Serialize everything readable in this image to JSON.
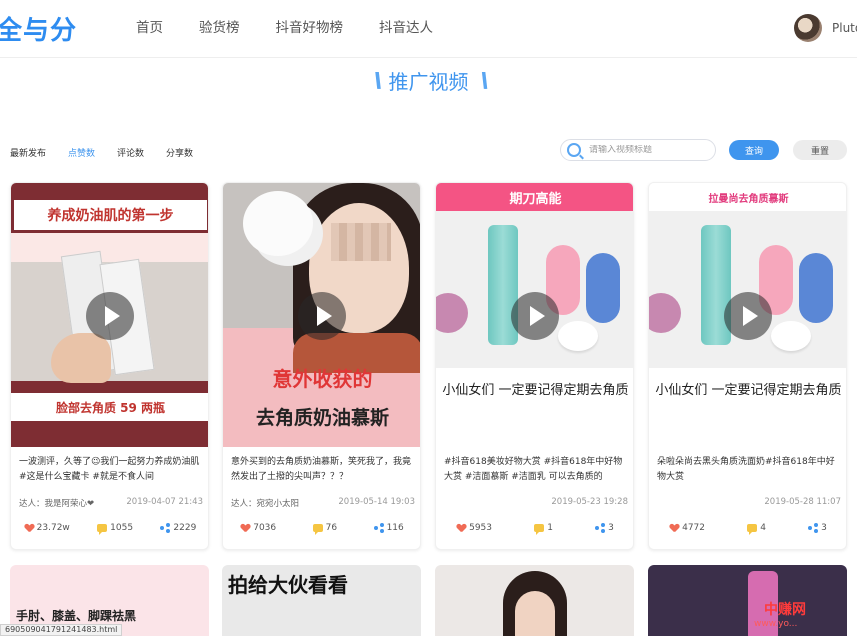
{
  "header": {
    "logo_text": "全与分",
    "nav": [
      "首页",
      "验货榜",
      "抖音好物榜",
      "抖音达人"
    ],
    "user_name": "Pluto"
  },
  "section": {
    "title": "推广视频"
  },
  "filters": {
    "sort_options": [
      "最新发布",
      "点赞数",
      "评论数",
      "分享数"
    ],
    "active_sort": "点赞数",
    "search_placeholder": "请输入视频标题",
    "query_label": "查询",
    "reset_label": "重置"
  },
  "cards": [
    {
      "thumb_top": "养成奶油肌的第一步",
      "thumb_bottom": "脸部去角质 59 两瓶",
      "desc": "一波测评，久等了😉我们一起努力养成奶油肌#这是什么宝藏卡 #就是不食人间",
      "author": "达人：我是阿荣心❤",
      "date": "2019-04-07 21:43",
      "likes": "23.72w",
      "comments": "1055",
      "shares": "2229"
    },
    {
      "thumb_top": "意外收获的",
      "thumb_bottom": "去角质奶油慕斯",
      "desc": "意外买到的去角质奶油慕斯，笑死我了，我竟然发出了土撥的尖叫声？？？",
      "author": "达人：宛宛小太阳",
      "date": "2019-05-14 19:03",
      "likes": "7036",
      "comments": "76",
      "shares": "116"
    },
    {
      "thumb_top": "期刀高能",
      "thumb_bottom": "小仙女们 一定要记得定期去角质",
      "desc": "#抖音618美妆好物大赏 #抖音618年中好物大赏 #洁面慕斯 #洁面乳 可以去角质的",
      "author": "",
      "date": "2019-05-23 19:28",
      "likes": "5953",
      "comments": "1",
      "shares": "3"
    },
    {
      "thumb_top": "拉曼尚去角质慕斯",
      "thumb_bottom": "小仙女们 一定要记得定期去角质",
      "desc": "朵啦朵尚去黑头角质洗面奶#抖音618年中好物大赏",
      "author": "",
      "date": "2019-05-28 11:07",
      "likes": "4772",
      "comments": "4",
      "shares": "3"
    }
  ],
  "row2": {
    "card1_text": "手肘、膝盖、脚踝祛黑 ",
    "card2_text": "拍给大伙看看",
    "watermark": "中赚网",
    "watermark_url": "www.yo..."
  },
  "status_url": "69050904179124148​3.html",
  "colors": {
    "accent": "#3f95ee",
    "like": "#f06b55",
    "comment": "#f5c542"
  }
}
